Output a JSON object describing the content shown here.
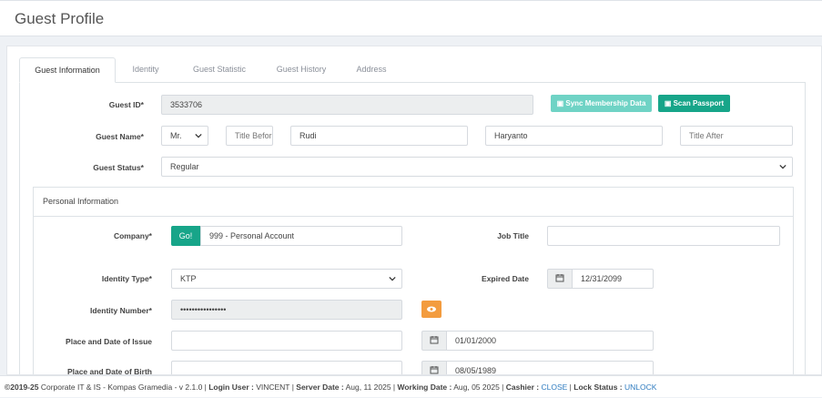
{
  "page": {
    "title": "Guest Profile"
  },
  "tabs": [
    "Guest Information",
    "Identity",
    "Guest Statistic",
    "Guest History",
    "Address"
  ],
  "guest": {
    "id_label": "Guest ID*",
    "id_value": "3533706",
    "sync_button": "Sync Membership Data",
    "scan_button": "Scan Passport",
    "name_label": "Guest Name*",
    "salutation": "Mr.",
    "title_before_placeholder": "Title Before",
    "first_name": "Rudi",
    "last_name": "Haryanto",
    "title_after_placeholder": "Title After",
    "status_label": "Guest Status*",
    "status_value": "Regular"
  },
  "personal": {
    "heading": "Personal Information",
    "company_label": "Company*",
    "company_go": "Go!",
    "company_value": "999 - Personal Account",
    "job_title_label": "Job Title",
    "job_title_value": "",
    "identity_type_label": "Identity Type*",
    "identity_type_value": "KTP",
    "expired_date_label": "Expired Date",
    "expired_date_value": "12/31/2099",
    "identity_number_label": "Identity Number*",
    "identity_number_value": "••••••••••••••••",
    "place_issue_label": "Place and Date of Issue",
    "place_issue_value": "",
    "date_issue_value": "01/01/2000",
    "place_birth_label": "Place and Date of Birth",
    "place_birth_value": "",
    "date_birth_value": "08/05/1989"
  },
  "footer": {
    "copyright": "©2019-25",
    "org": " Corporate IT & IS - Kompas Gramedia - v 2.1.0 | ",
    "login_label": "Login User :",
    "login_value": " VINCENT | ",
    "server_label": "Server Date :",
    "server_value": " Aug, 11 2025 | ",
    "working_label": "Working Date :",
    "working_value": " Aug, 05 2025 | ",
    "cashier_label": "Cashier :",
    "cashier_value": "CLOSE",
    "sep": " | ",
    "lock_label": "Lock Status :",
    "lock_value": "UNLOCK"
  },
  "colors": {
    "accent": "#17a589",
    "accent_light": "#6fd3c5",
    "warning": "#f39c3f",
    "link": "#2e7bbf"
  },
  "icons": {
    "calendar": "calendar-icon",
    "eye": "eye-icon",
    "chevron": "chevron-down-icon"
  }
}
